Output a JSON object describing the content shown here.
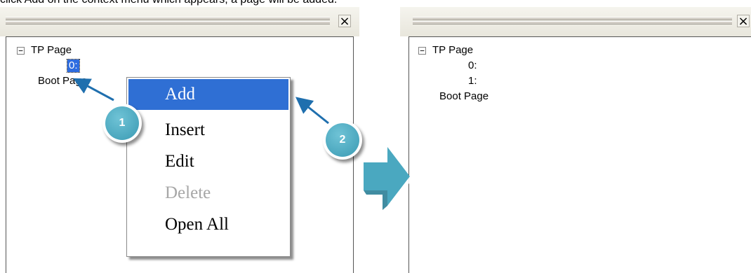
{
  "caption": "click Add on the context menu which appears, a page will be added.",
  "left_panel": {
    "close_glyph": "×",
    "tree": {
      "root_label": "TP Page",
      "toggle_glyph": "−",
      "page_items": [
        "0:"
      ],
      "sibling_label": "Boot Page"
    }
  },
  "context_menu": {
    "items": [
      {
        "label": "Add",
        "state": "highlighted"
      },
      {
        "label": "Insert",
        "state": "normal"
      },
      {
        "label": "Edit",
        "state": "normal"
      },
      {
        "label": "Delete",
        "state": "disabled"
      },
      {
        "label": "Open All",
        "state": "normal"
      }
    ],
    "highlight_color": "#2f6fd4"
  },
  "step_badges": [
    {
      "number": "1"
    },
    {
      "number": "2"
    }
  ],
  "right_panel": {
    "close_glyph": "×",
    "tree": {
      "root_label": "TP Page",
      "toggle_glyph": "−",
      "page_items": [
        "0:",
        "1:"
      ],
      "sibling_label": "Boot Page"
    }
  },
  "colors": {
    "arrow": "#1f6fae",
    "callout": "#4aa8c0",
    "selection": "#2d6ce0"
  }
}
